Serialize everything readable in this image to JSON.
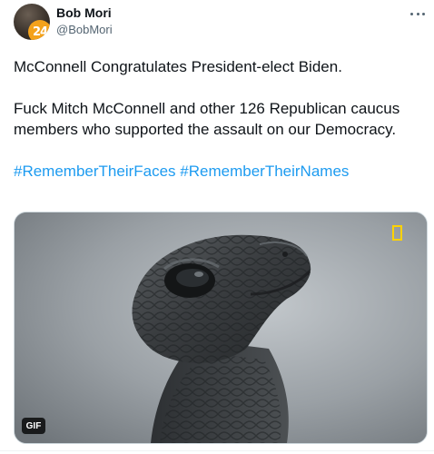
{
  "user": {
    "name": "Bob Mori",
    "handle": "@BobMori",
    "avatar_badge_text": "24",
    "more_icon": "more-horizontal-icon"
  },
  "tweet": {
    "line1": "McConnell Congratulates President-elect Biden.",
    "line2": "Fuck Mitch McConnell and other 126 Republican caucus members who supported the assault on our Democracy.",
    "hashtags": [
      "#RememberTheirFaces",
      "#RememberTheirNames"
    ]
  },
  "media": {
    "badge": "GIF",
    "description_icon": "turtle-image",
    "logo_icon": "yellow-border-logo-icon"
  },
  "colors": {
    "text": "#0f1419",
    "secondary": "#536471",
    "link": "#1d9bf0",
    "logo": "#ffd200"
  }
}
